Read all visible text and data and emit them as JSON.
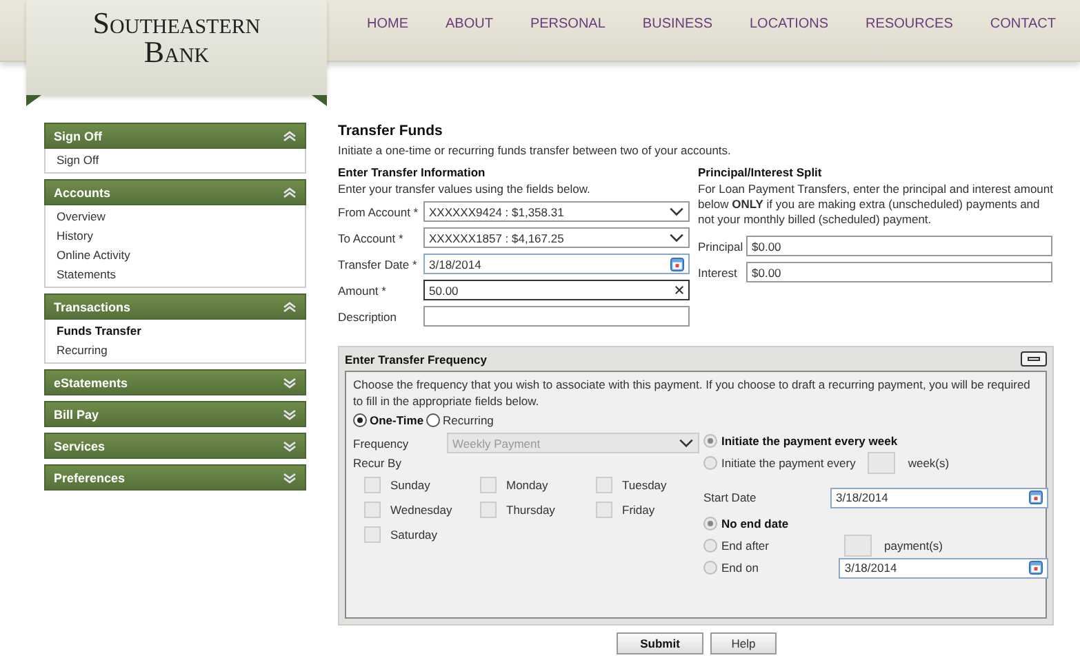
{
  "header": {
    "logo": {
      "line1": "Southeastern",
      "line2": "Bank"
    },
    "nav": [
      "HOME",
      "ABOUT",
      "PERSONAL",
      "BUSINESS",
      "LOCATIONS",
      "RESOURCES",
      "CONTACT"
    ]
  },
  "sidebar": {
    "sections": [
      {
        "title": "Sign Off",
        "expanded": true,
        "items": [
          {
            "label": "Sign Off",
            "selected": false
          }
        ]
      },
      {
        "title": "Accounts",
        "expanded": true,
        "items": [
          {
            "label": "Overview",
            "selected": false
          },
          {
            "label": "History",
            "selected": false
          },
          {
            "label": "Online Activity",
            "selected": false
          },
          {
            "label": "Statements",
            "selected": false
          }
        ]
      },
      {
        "title": "Transactions",
        "expanded": true,
        "items": [
          {
            "label": "Funds Transfer",
            "selected": true
          },
          {
            "label": "Recurring",
            "selected": false
          }
        ]
      },
      {
        "title": "eStatements",
        "expanded": false
      },
      {
        "title": "Bill Pay",
        "expanded": false
      },
      {
        "title": "Services",
        "expanded": false
      },
      {
        "title": "Preferences",
        "expanded": false
      }
    ]
  },
  "page": {
    "title": "Transfer Funds",
    "intro": "Initiate a one-time or recurring funds transfer between two of your accounts."
  },
  "transfer_info": {
    "heading": "Enter Transfer Information",
    "hint": "Enter your transfer values using the fields below.",
    "fields": [
      {
        "label": "From Account *",
        "kind": "select",
        "value": "XXXXXX9424 : $1,358.31"
      },
      {
        "label": "To Account *",
        "kind": "select",
        "value": "XXXXXX1857 : $4,167.25"
      },
      {
        "label": "Transfer Date *",
        "kind": "date",
        "value": "3/18/2014"
      },
      {
        "label": "Amount *",
        "kind": "clearable",
        "value": "50.00"
      },
      {
        "label": "Description",
        "kind": "text"
      }
    ]
  },
  "split": {
    "heading": "Principal/Interest Split",
    "note": "For Loan Payment Transfers, enter the principal and interest amount below **ONLY** if you are making extra (unscheduled) payments and not your monthly billed (scheduled) payment.",
    "fields": [
      {
        "label": "Principal",
        "value": "$0.00"
      },
      {
        "label": "Interest",
        "value": "$0.00"
      }
    ]
  },
  "frequency": {
    "title": "Enter Transfer Frequency",
    "description": "Choose the frequency that you wish to associate with this payment. If you choose to draft a recurring payment, you will be required to fill in the appropriate fields below.",
    "modes": [
      {
        "label": "One-Time",
        "selected": true
      },
      {
        "label": "Recurring",
        "selected": false
      }
    ],
    "recurring_disabled": true,
    "frequency_label": "Frequency",
    "frequency_value": "Weekly Payment",
    "recur_label": "Recur By",
    "days": [
      {
        "label": "Sunday",
        "checked": false
      },
      {
        "label": "Monday",
        "checked": false
      },
      {
        "label": "Tuesday",
        "checked": false
      },
      {
        "label": "Wednesday",
        "checked": false
      },
      {
        "label": "Thursday",
        "checked": false
      },
      {
        "label": "Friday",
        "checked": false
      },
      {
        "label": "Saturday",
        "checked": false
      }
    ],
    "week_options": [
      {
        "label": "Initiate the payment every week",
        "selected": true
      },
      {
        "label": "Initiate the payment every",
        "selected": false,
        "suffix": "week(s)"
      }
    ],
    "start_date_label": "Start Date",
    "start_date": "3/18/2014",
    "end_options": [
      {
        "label": "No end date",
        "selected": true
      },
      {
        "label": "End after",
        "selected": false,
        "suffix": "payment(s)"
      },
      {
        "label": "End on",
        "selected": false,
        "date": "3/18/2014"
      }
    ]
  },
  "buttons": [
    "Submit",
    "Help"
  ]
}
